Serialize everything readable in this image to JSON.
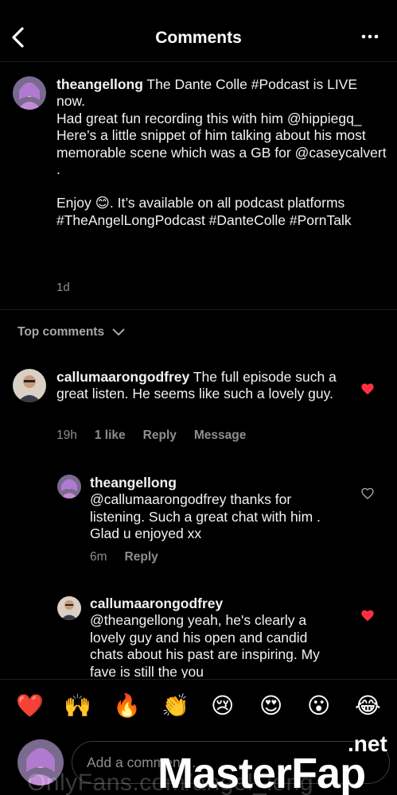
{
  "header": {
    "title": "Comments"
  },
  "post": {
    "username": "theangellong",
    "line1": " The Dante Colle #Podcast is LIVE now.",
    "line2": "Had great fun recording this with him @hippiegq_",
    "line3": "Here’s a little snippet of him talking about his most memorable scene which was a GB for @caseycalvert .",
    "line4": "Enjoy 😊. It’s available on all podcast platforms #TheAngelLongPodcast #DanteColle #PornTalk",
    "time": "1d"
  },
  "top_comments": {
    "label": "Top comments"
  },
  "comments": [
    {
      "username": "callumaarongodfrey",
      "text": " The full episode such a great listen. He seems like such a lovely guy.",
      "time": "19h",
      "likes": "1 like",
      "reply": "Reply",
      "message": "Message",
      "liked": true
    },
    {
      "username": "theangellong",
      "text": "@callumaarongodfrey thanks for listening. Such a great chat with him . Glad u enjoyed xx",
      "time": "6m",
      "reply": "Reply",
      "liked": false
    },
    {
      "username": "callumaarongodfrey",
      "text": "@theangellong yeah, he's clearly a lovely guy and his open and candid chats about his past are inspiring. My fave is still the you",
      "liked": true
    }
  ],
  "emoji_bar": [
    "❤️",
    "🙌",
    "🔥",
    "👏",
    "😢",
    "😍",
    "😮",
    "😂"
  ],
  "input": {
    "placeholder": "Add a comment..."
  },
  "watermark": {
    "site": "OnlyFans.com/angel_long",
    "brand": "MasterFap",
    "tld": ".net"
  },
  "colors": {
    "background": "#000000",
    "heart": "#ff3040",
    "secondary_text": "#8e8e8e"
  }
}
